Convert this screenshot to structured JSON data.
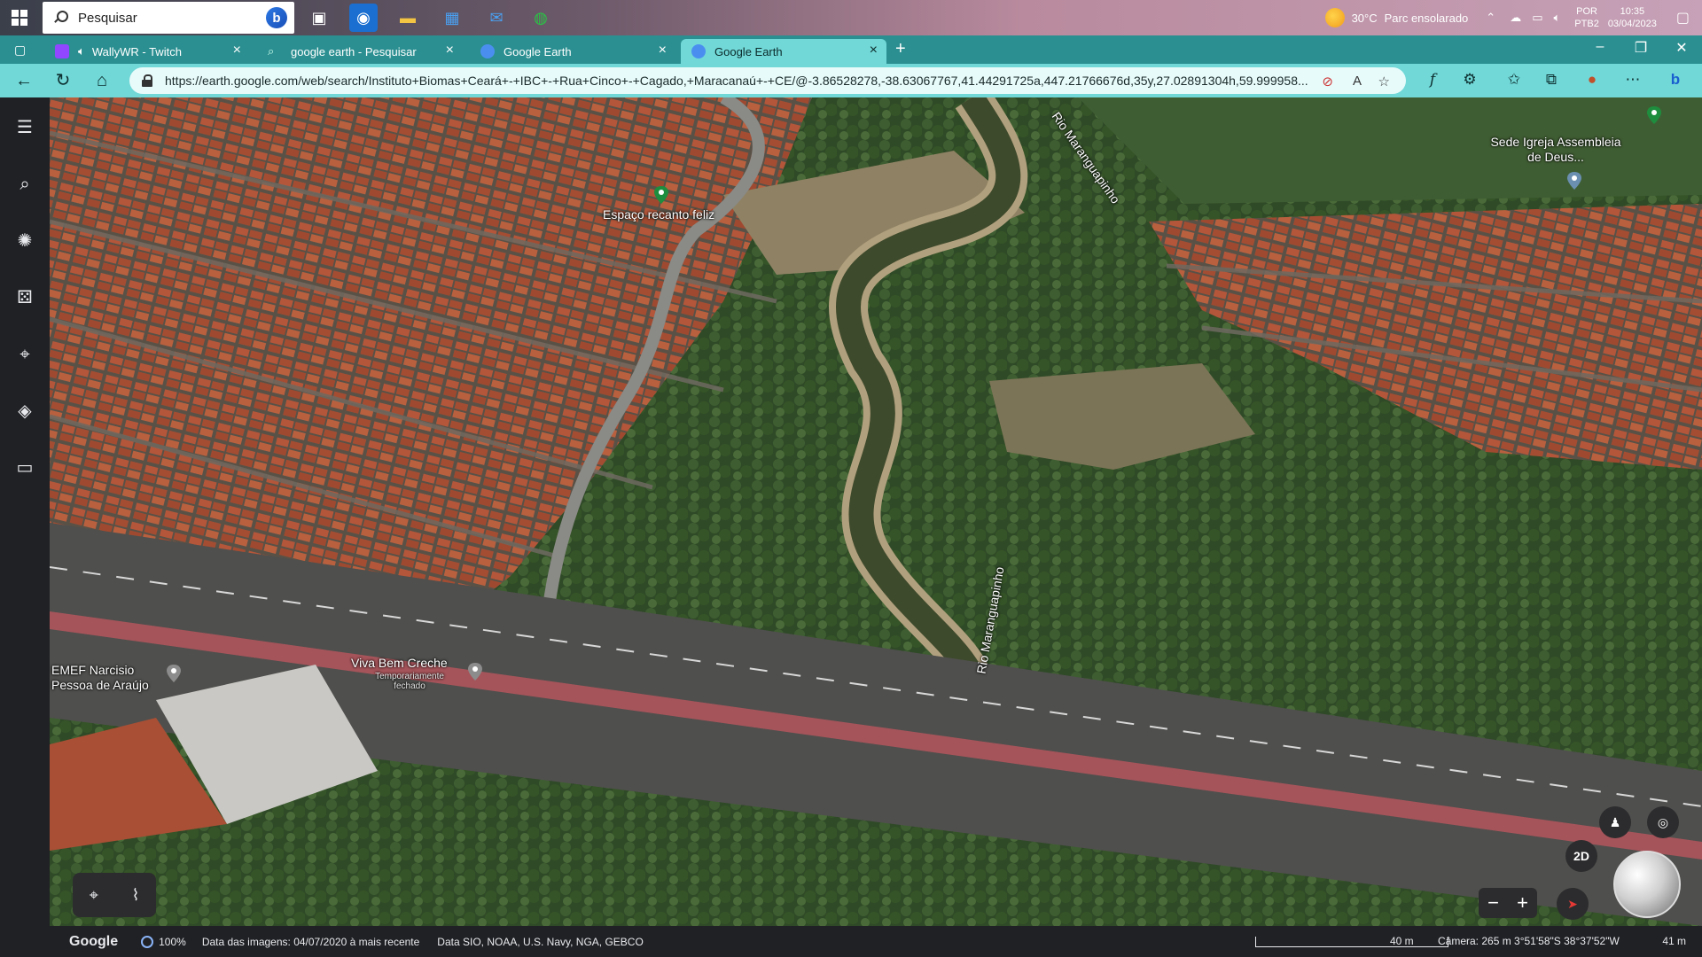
{
  "taskbar": {
    "search_text": "Pesquisar",
    "weather": "30°C",
    "weather_desc": "Parc ensolarado",
    "lang": "POR",
    "lang2": "PTB2",
    "time": "10:35",
    "date": "03/04/2023"
  },
  "tabs": [
    {
      "label": "WallyWR - Twitch",
      "favicon_color": "#9146ff"
    },
    {
      "label": "google earth - Pesquisar",
      "favicon_color": "#2f6fe0"
    },
    {
      "label": "Google Earth",
      "favicon_color": "#4a8ff0"
    },
    {
      "label": "Google Earth",
      "favicon_color": "#4a8ff0"
    }
  ],
  "address": {
    "url": "https://earth.google.com/web/search/Instituto+Biomas+Ceará+-+IBC+-+Rua+Cinco+-+Cagado,+Maracanaú+-+CE/@-3.86528278,-38.63067767,41.44291725a,447.21766676d,35y,27.02891304h,59.999958..."
  },
  "map": {
    "labels": {
      "river1": "Rio Maranguapinho",
      "river2": "Rio Maranguapinho",
      "espaco": "Espaço recanto feliz",
      "igreja": "Sede Igreja Assembleia de Deus...",
      "emef": "EMEF Narcisio Pessoa de Araújo",
      "creche": "Viva Bem Creche",
      "creche_status": "Temporariamente fechado"
    },
    "mode_2d": "2D"
  },
  "status": {
    "brand": "Google",
    "progress": "100%",
    "image_date": "Data das imagens: 04/07/2020 à mais recente",
    "credits": "Data SIO, NOAA, U.S. Navy, NGA, GEBCO",
    "scale": "40 m",
    "camera": "Câmera: 265 m   3°51'58\"S 38°37'52\"W",
    "altitude": "41 m"
  },
  "colors": {
    "tabstrip": "#2b8f91",
    "navbar": "#71d8d7",
    "rail": "#202124"
  }
}
